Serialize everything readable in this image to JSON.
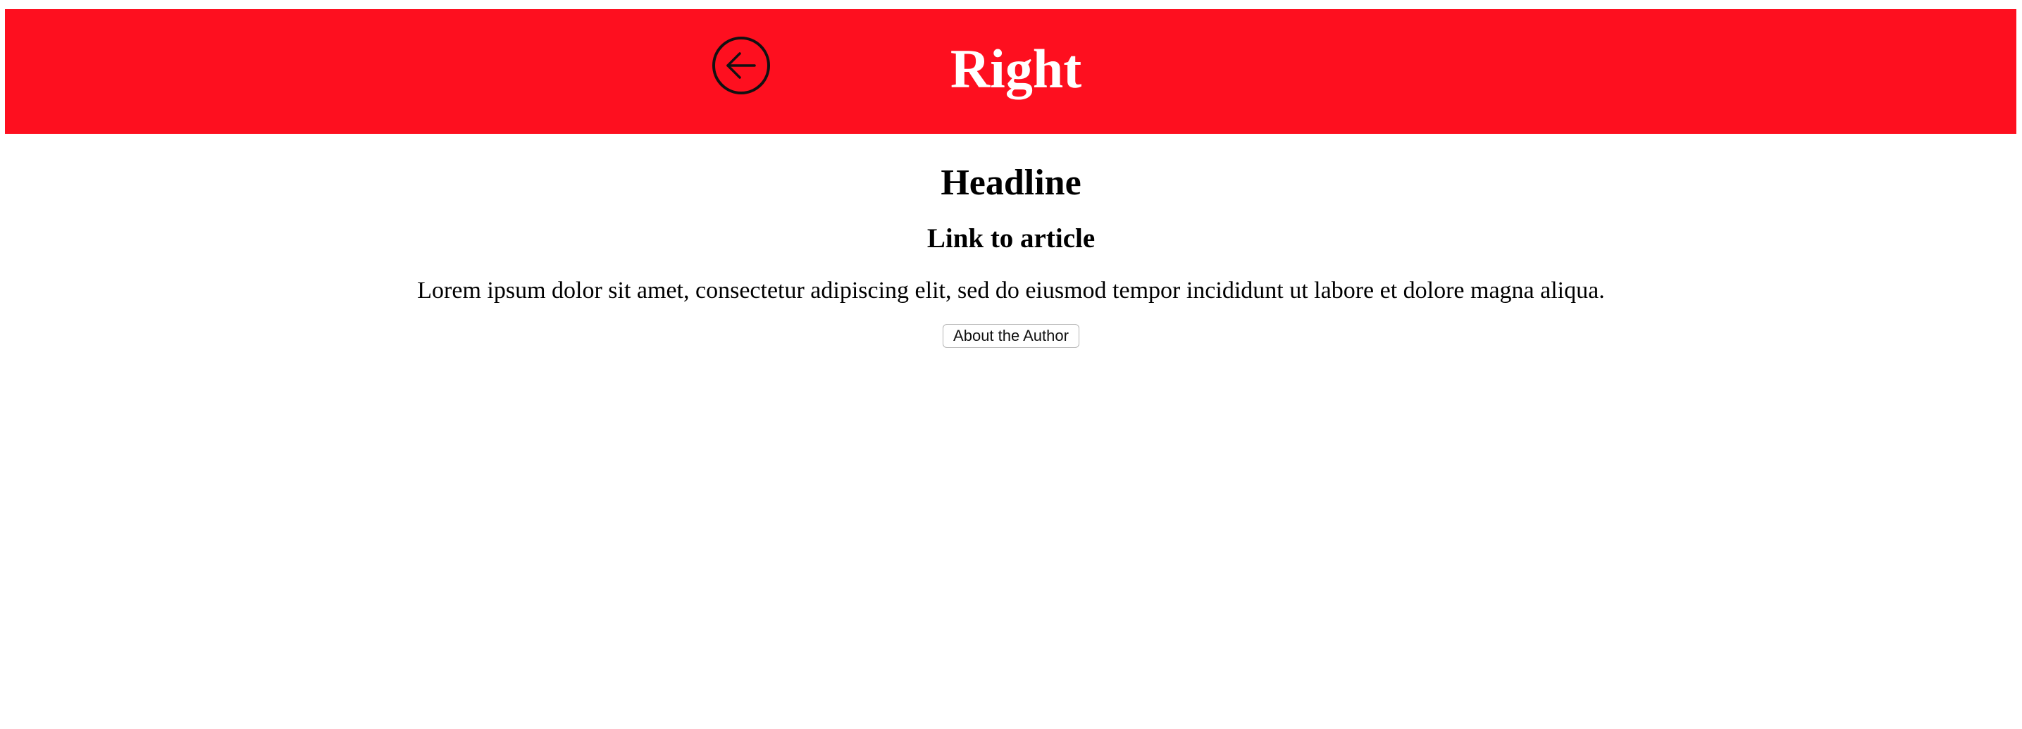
{
  "header": {
    "title": "Right",
    "back_icon": "arrow-left-circle-icon",
    "background_color": "#fe0f1f",
    "title_color": "#ffffff"
  },
  "main": {
    "headline": "Headline",
    "article_link": "Link to article",
    "body": "Lorem ipsum dolor sit amet, consectetur adipiscing elit, sed do eiusmod tempor incididunt ut labore et dolore magna aliqua.",
    "author_button": "About the Author"
  }
}
